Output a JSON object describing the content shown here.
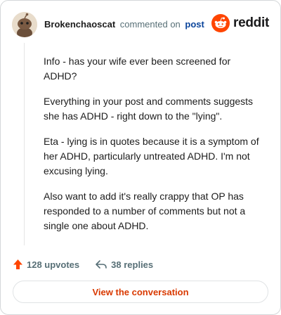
{
  "header": {
    "username": "Brokenchaoscat",
    "action": "commented on",
    "post_link": "post",
    "brand_word": "reddit"
  },
  "comment": {
    "paragraphs": [
      "Info - has your wife ever been screened for ADHD?",
      "Everything in your post and comments suggests she has ADHD - right down to the \"lying\".",
      "Eta - lying is in quotes because it is a symptom of her ADHD, particularly untreated ADHD. I'm not excusing lying.",
      "Also want to add it's really crappy that OP has responded to a number of comments but not a single one about ADHD."
    ]
  },
  "footer": {
    "upvotes": "128 upvotes",
    "replies": "38 replies"
  },
  "cta": {
    "label": "View the conversation"
  },
  "colors": {
    "brand": "#ff4500",
    "link": "#0a449b",
    "cta_text": "#d93900",
    "muted": "#576f76",
    "upvote_icon": "#ff4500"
  },
  "icons": {
    "avatar": "snoo-avatar-icon",
    "brand": "reddit-logo-icon",
    "upvote": "upvote-arrow-icon",
    "reply": "reply-arrow-icon"
  }
}
